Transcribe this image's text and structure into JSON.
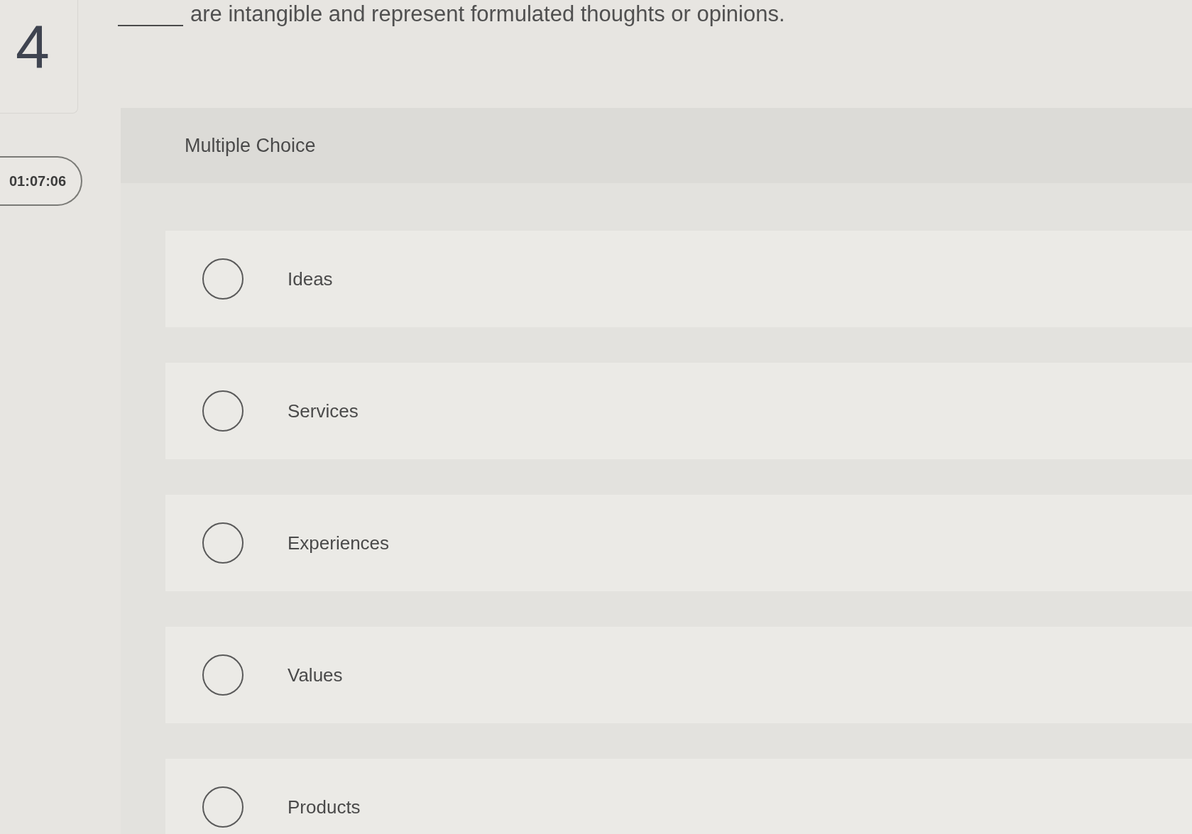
{
  "question": {
    "number": "4",
    "timer": "01:07:06",
    "text": "are intangible and represent formulated thoughts or opinions."
  },
  "answer": {
    "type_label": "Multiple Choice",
    "options": [
      {
        "label": "Ideas",
        "selected": false
      },
      {
        "label": "Services",
        "selected": false
      },
      {
        "label": "Experiences",
        "selected": false
      },
      {
        "label": "Values",
        "selected": false
      },
      {
        "label": "Products",
        "selected": false
      }
    ]
  }
}
